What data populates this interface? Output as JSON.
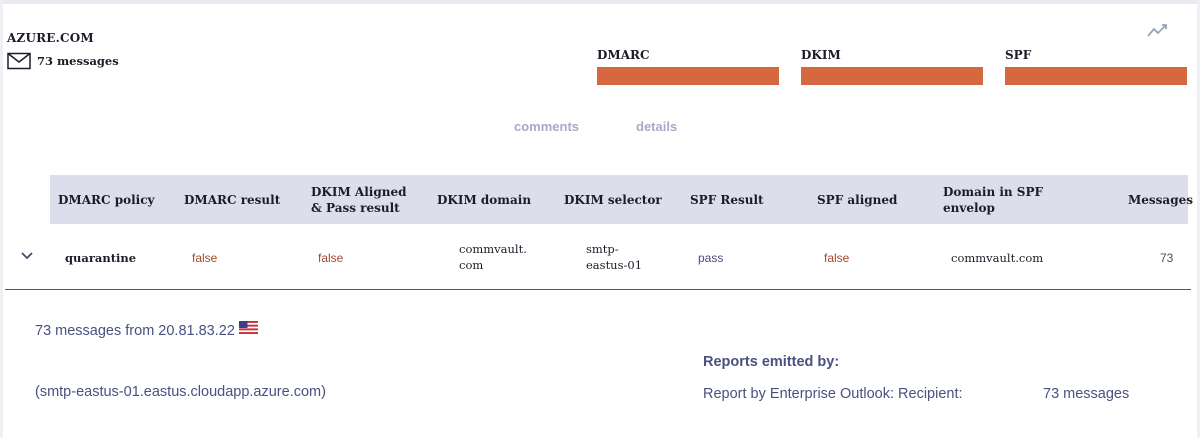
{
  "domain": {
    "name": "AZURE.COM",
    "message_count": "73 messages"
  },
  "icons": {
    "mail": "mail-icon",
    "trend": "trend-chart-icon",
    "expand": "chevron-down-icon",
    "flag": "us-flag-icon"
  },
  "auth": [
    {
      "label": "DMARC",
      "color": "#d6683f"
    },
    {
      "label": "DKIM",
      "color": "#d6683f"
    },
    {
      "label": "SPF",
      "color": "#d6683f"
    }
  ],
  "tabs": {
    "comments": "comments",
    "details": "details"
  },
  "table": {
    "headers": {
      "dmarc_policy": "DMARC policy",
      "dmarc_result": "DMARC result",
      "dkim_aligned_1": "DKIM Aligned",
      "dkim_aligned_2": "& Pass result",
      "dkim_domain": "DKIM domain",
      "dkim_selector": "DKIM selector",
      "spf_result": "SPF Result",
      "spf_aligned": "SPF aligned",
      "domain_spf_1": "Domain in SPF",
      "domain_spf_2": "envelop",
      "messages": "Messages"
    },
    "row": {
      "dmarc_policy": "quarantine",
      "dmarc_result": "false",
      "dkim_aligned": "false",
      "dkim_domain_1": "commvault.",
      "dkim_domain_2": "com",
      "dkim_selector_1": "smtp-",
      "dkim_selector_2": "eastus-01",
      "spf_result": "pass",
      "spf_aligned": "false",
      "domain_spf": "commvault.com",
      "messages": "73"
    }
  },
  "details": {
    "source": "73 messages from 20.81.83.22",
    "hostname": "(smtp-eastus-01.eastus.cloudapp.azure.com)",
    "reports_title": "Reports emitted by:",
    "reporter": "Report by Enterprise Outlook: Recipient:",
    "reporter_count": "73 messages"
  },
  "colors": {
    "fail_bar": "#d6683f",
    "header_bg": "#dcdeec",
    "false_text": "#a24a2e",
    "link_muted": "#a7aac8"
  }
}
